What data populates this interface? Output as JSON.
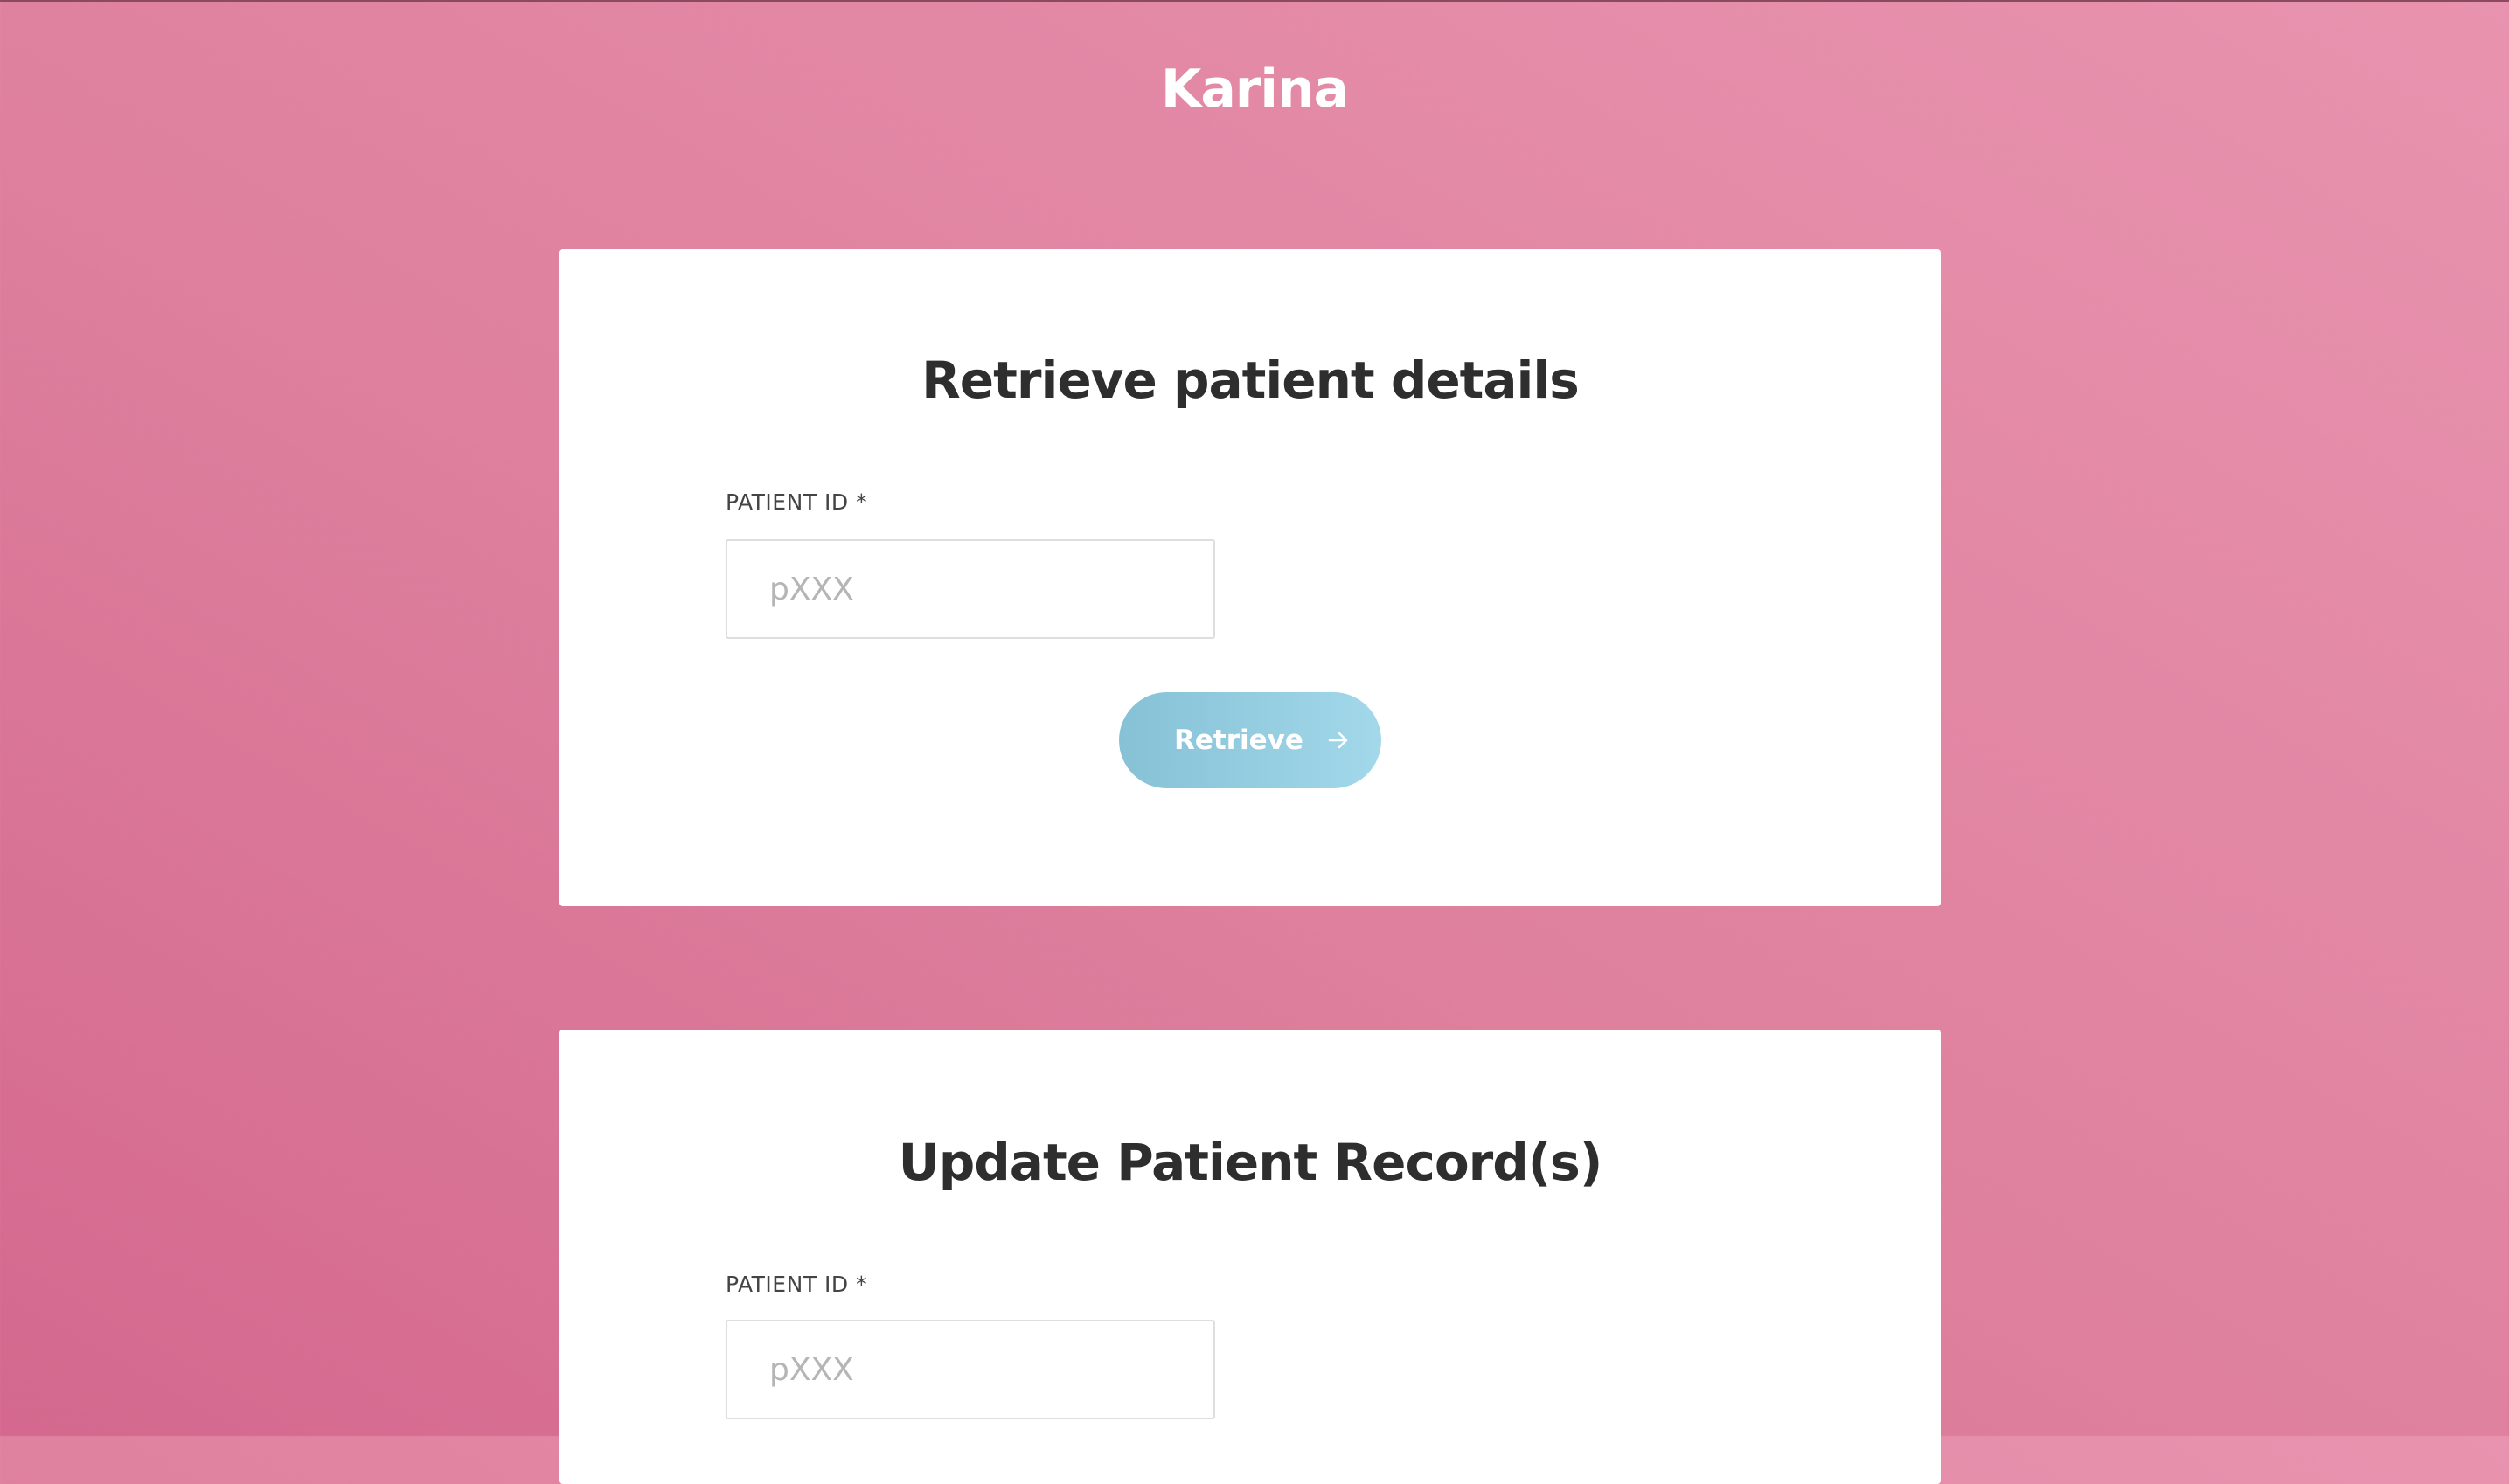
{
  "app": {
    "title": "Karina"
  },
  "retrieve_card": {
    "heading": "Retrieve patient details",
    "patient_id_label": "PATIENT ID *",
    "patient_id_placeholder": "pXXX",
    "patient_id_value": "",
    "button_label": "Retrieve",
    "button_icon": "arrow-right-icon"
  },
  "update_card": {
    "heading": "Update Patient Record(s)",
    "patient_id_label": "PATIENT ID *",
    "patient_id_placeholder": "pXXX",
    "patient_id_value": ""
  },
  "colors": {
    "background_start": "#d4688e",
    "background_end": "#e893af",
    "button_start": "#86c1d6",
    "button_end": "#a2d8ea",
    "heading_text": "#2e2e2e"
  }
}
